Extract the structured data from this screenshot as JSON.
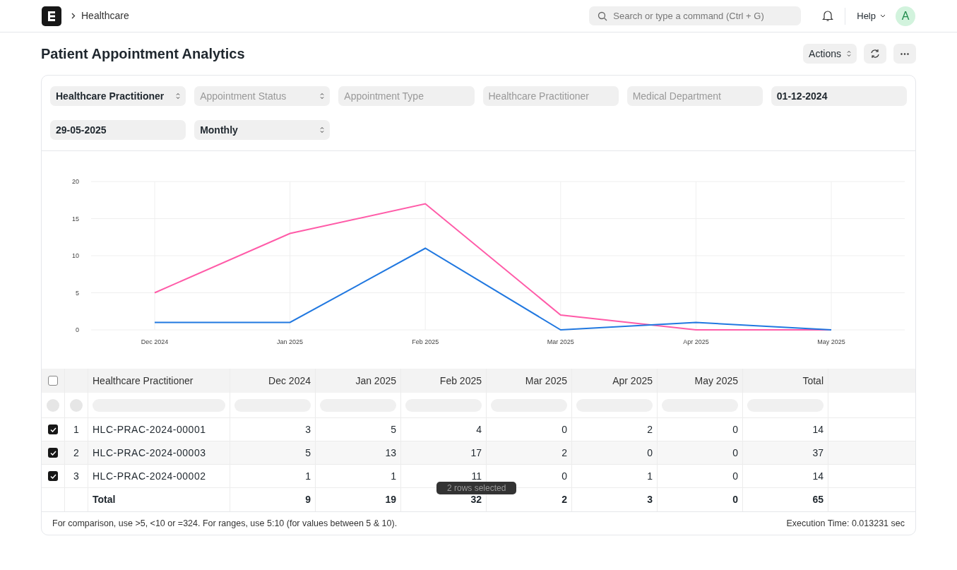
{
  "navbar": {
    "breadcrumb": "Healthcare",
    "search_placeholder": "Search or type a command (Ctrl + G)",
    "help": "Help",
    "avatar": "A"
  },
  "page": {
    "title": "Patient Appointment Analytics",
    "actions": "Actions"
  },
  "filters": [
    {
      "kind": "select",
      "value": "Healthcare Practitioner"
    },
    {
      "kind": "select",
      "placeholder": "Appointment Status"
    },
    {
      "kind": "input",
      "placeholder": "Appointment Type"
    },
    {
      "kind": "input",
      "placeholder": "Healthcare Practitioner"
    },
    {
      "kind": "input",
      "placeholder": "Medical Department"
    },
    {
      "kind": "input",
      "value": "01-12-2024"
    },
    {
      "kind": "input",
      "value": "29-05-2025"
    },
    {
      "kind": "select",
      "value": "Monthly"
    }
  ],
  "chart_data": {
    "type": "line",
    "grid": true,
    "categories": [
      "Dec 2024",
      "Jan 2025",
      "Feb 2025",
      "Mar 2025",
      "Apr 2025",
      "May 2025"
    ],
    "ylim": [
      0,
      20
    ],
    "yticks": [
      0,
      5,
      10,
      15,
      20
    ],
    "series": [
      {
        "color": "#ff5ba8",
        "values": [
          5,
          13,
          17,
          2,
          0,
          0
        ]
      },
      {
        "color": "#2178e0",
        "values": [
          1,
          1,
          11,
          0,
          1,
          0
        ]
      }
    ]
  },
  "table": {
    "all_checked": false,
    "columns": [
      "Healthcare Practitioner",
      "Dec 2024",
      "Jan 2025",
      "Feb 2025",
      "Mar 2025",
      "Apr 2025",
      "May 2025",
      "Total"
    ],
    "rows": [
      {
        "selected": true,
        "index": "1",
        "cells": [
          "HLC-PRAC-2024-00001",
          "3",
          "5",
          "4",
          "0",
          "2",
          "0",
          "14"
        ]
      },
      {
        "selected": true,
        "index": "2",
        "cells": [
          "HLC-PRAC-2024-00003",
          "5",
          "13",
          "17",
          "2",
          "0",
          "0",
          "37"
        ]
      },
      {
        "selected": true,
        "index": "3",
        "cells": [
          "HLC-PRAC-2024-00002",
          "1",
          "1",
          "11",
          "0",
          "1",
          "0",
          "14"
        ]
      }
    ],
    "total": [
      "Total",
      "9",
      "19",
      "32",
      "2",
      "3",
      "0",
      "65"
    ]
  },
  "toast": "2 rows selected",
  "footer": {
    "hint": "For comparison, use >5, <10 or =324. For ranges, use 5:10 (for values between 5 & 10).",
    "execution_time": "Execution Time: 0.013231 sec"
  }
}
